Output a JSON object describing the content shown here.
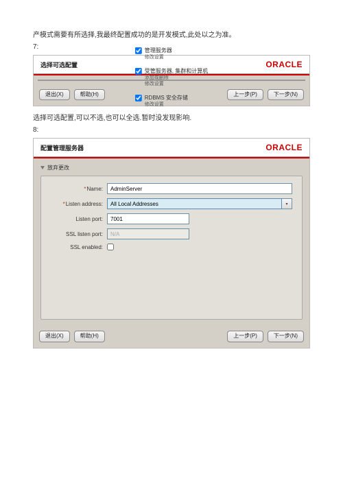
{
  "doc": {
    "text_before_7": "产模式需要有所选择,我最终配置成功的是开发模式,此处以之为准。",
    "step7": "7:",
    "text_before_8": "选择可选配置,可以不选,也可以全选.暂时没发现影响.",
    "step8": "8:"
  },
  "brand": "ORACLE",
  "footer": {
    "exit": "退出(X)",
    "help": "帮助(H)",
    "prev": "上一步(P)",
    "next": "下一步(N)"
  },
  "screen7": {
    "title": "选择可选配置",
    "opts": [
      {
        "checked": true,
        "label": "管理服务器",
        "subs": [
          "修改设置"
        ]
      },
      {
        "checked": true,
        "label": "受管服务器, 集群和计算机",
        "subs": [
          "添加或删除",
          "修改设置"
        ]
      },
      {
        "checked": true,
        "label": "RDBMS 安全存储",
        "subs": [
          "修改设置"
        ]
      }
    ]
  },
  "screen8": {
    "title": "配置管理服务器",
    "discard": "放弃更改",
    "fields": {
      "name_label": "*Name:",
      "name_value": "AdminServer",
      "listen_addr_label": "*Listen address:",
      "listen_addr_value": "All Local Addresses",
      "listen_port_label": "Listen port:",
      "listen_port_value": "7001",
      "ssl_port_label": "SSL listen port:",
      "ssl_port_value": "N/A",
      "ssl_enabled_label": "SSL enabled:"
    }
  }
}
